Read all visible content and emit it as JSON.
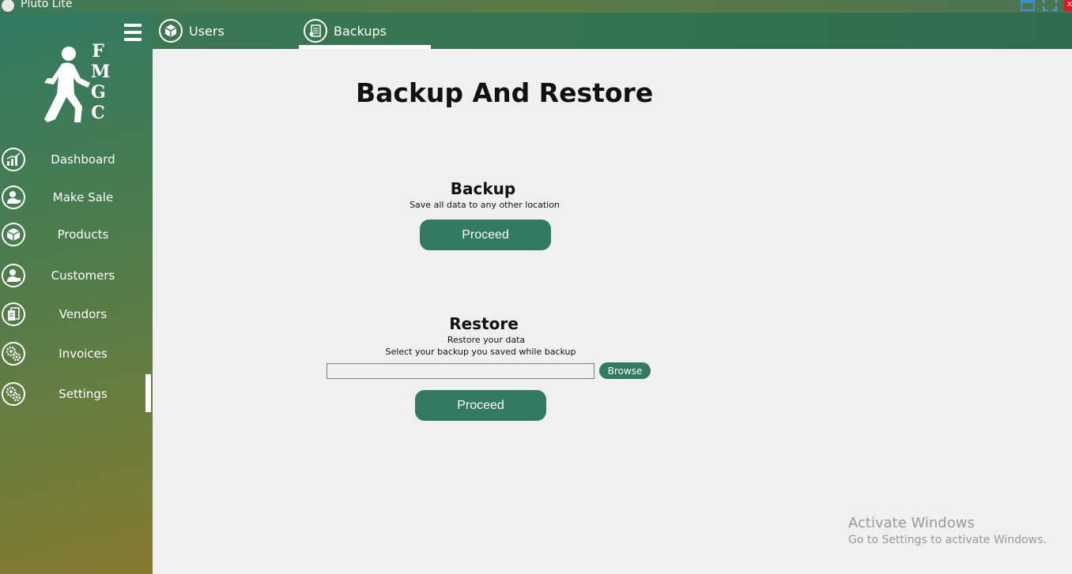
{
  "window": {
    "title": "Pluto Lite",
    "close_glyph": "x"
  },
  "logo": {
    "letters": [
      "F",
      "M",
      "G",
      "C"
    ],
    "icon": "walking-man-icon"
  },
  "topbar": {
    "tabs": [
      {
        "label": "Users",
        "icon": "box-icon"
      },
      {
        "label": "Backups",
        "icon": "backup-list-icon"
      }
    ],
    "active_tab": "Backups"
  },
  "sidebar": {
    "items": [
      {
        "label": "Dashboard",
        "icon": "chart-icon"
      },
      {
        "label": "Make Sale",
        "icon": "user-cart-icon"
      },
      {
        "label": "Products",
        "icon": "box-icon"
      },
      {
        "label": "Customers",
        "icon": "user-cart-icon"
      },
      {
        "label": "Vendors",
        "icon": "vendor-doc-icon"
      },
      {
        "label": "Invoices",
        "icon": "gears-icon"
      },
      {
        "label": "Settings",
        "icon": "gears-icon"
      }
    ],
    "active_item": "Settings"
  },
  "main": {
    "title": "Backup And Restore",
    "backup": {
      "heading": "Backup",
      "description": "Save all data to any other location",
      "button_label": "Proceed"
    },
    "restore": {
      "heading": "Restore",
      "description_line1": "Restore your data",
      "description_line2": "Select your backup you saved while backup",
      "path_value": "",
      "browse_label": "Browse",
      "button_label": "Proceed"
    }
  },
  "watermark": {
    "line1": "Activate Windows",
    "line2": "Go to Settings to activate Windows."
  },
  "colors": {
    "accent": "#327a62",
    "sidebar_top": "#2f7a62",
    "sidebar_bottom": "#857a2e",
    "background": "#f0f0f0"
  }
}
